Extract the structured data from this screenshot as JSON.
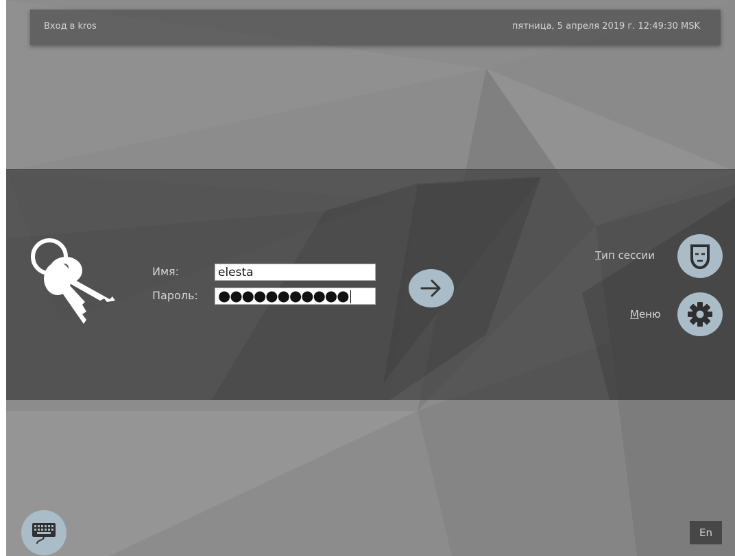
{
  "header": {
    "title": "Вход в kros",
    "datetime": "пятница, 5 апреля 2019 г. 12:49:30 MSK"
  },
  "login": {
    "username_label": "Имя:",
    "username_value": "elesta",
    "password_label": "Пароль:",
    "password_masked": "●●●●●●●●●●●"
  },
  "actions": {
    "session_type_label_accel": "Т",
    "session_type_label_rest": "ип сессии",
    "menu_label_accel": "М",
    "menu_label_rest": "еню"
  },
  "footer": {
    "language": "En"
  },
  "icons": {
    "login": "keys-icon",
    "submit": "arrow-right-icon",
    "session": "mask-icon",
    "menu": "gear-icon",
    "keyboard": "keyboard-icon"
  },
  "colors": {
    "background": "#8a8a8a",
    "band": "#474747",
    "button": "#a9bcc7",
    "text": "#d6d6d6"
  }
}
